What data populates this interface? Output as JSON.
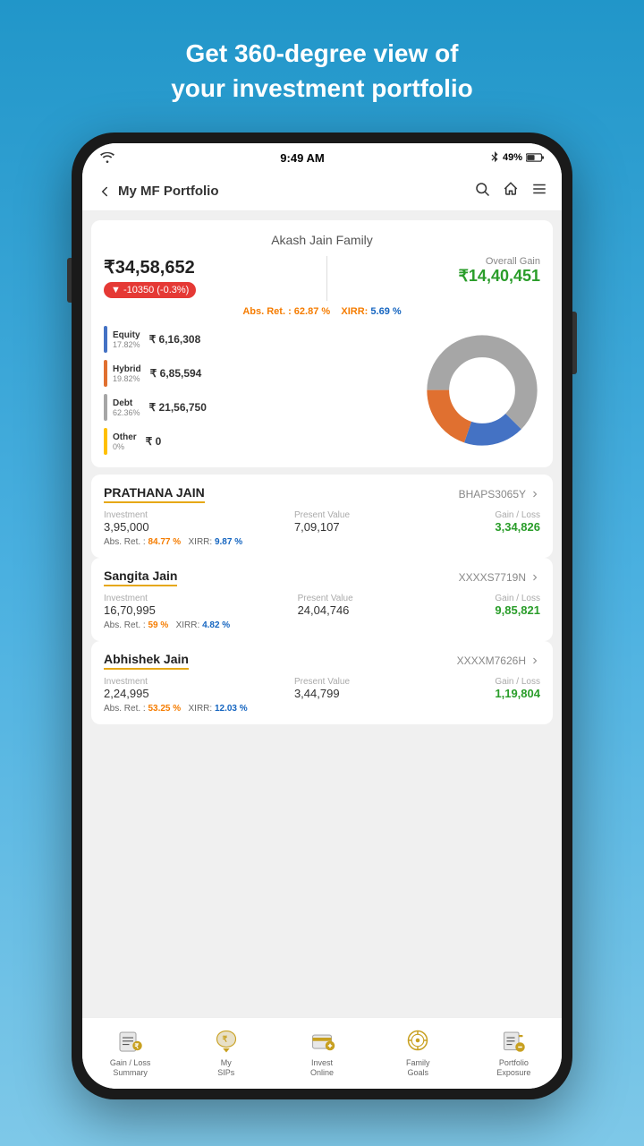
{
  "hero": {
    "line1": "Get 360-degree view of",
    "line2": "your investment portfolio"
  },
  "statusBar": {
    "time": "9:49 AM",
    "battery": "49%"
  },
  "navBar": {
    "backLabel": "My MF Portfolio"
  },
  "summaryCard": {
    "familyName": "Akash Jain Family",
    "totalValue": "₹34,58,652",
    "change": "▼ -10350  (-0.3%)",
    "overallGainLabel": "Overall Gain",
    "overallGainValue": "₹14,40,451",
    "absRet": "Abs. Ret. :  62.87 %",
    "xirr": "XIRR: 5.69 %",
    "categories": [
      {
        "name": "Equity",
        "pct": "17.82%",
        "value": "₹ 6,16,308",
        "color": "#4472c4"
      },
      {
        "name": "Hybrid",
        "pct": "19.82%",
        "value": "₹ 6,85,594",
        "color": "#e07030"
      },
      {
        "name": "Debt",
        "pct": "62.36%",
        "value": "₹ 21,56,750",
        "color": "#a6a6a6"
      },
      {
        "name": "Other",
        "pct": "0%",
        "value": "₹ 0",
        "color": "#ffc000"
      }
    ],
    "chart": {
      "segments": [
        {
          "label": "Equity",
          "value": 17.82,
          "color": "#4472c4"
        },
        {
          "label": "Hybrid",
          "value": 19.82,
          "color": "#e07030"
        },
        {
          "label": "Debt",
          "value": 62.36,
          "color": "#a6a6a6"
        }
      ]
    }
  },
  "persons": [
    {
      "name": "PRATHANA JAIN",
      "id": "BHAPS3065Y",
      "investment": "3,95,000",
      "presentValue": "7,09,107",
      "gainLoss": "3,34,826",
      "absRet": "84.77 %",
      "xirr": "9.87 %"
    },
    {
      "name": "Sangita Jain",
      "id": "XXXXS7719N",
      "investment": "16,70,995",
      "presentValue": "24,04,746",
      "gainLoss": "9,85,821",
      "absRet": "59 %",
      "xirr": "4.82 %"
    },
    {
      "name": "Abhishek Jain",
      "id": "XXXXM7626H",
      "investment": "2,24,995",
      "presentValue": "3,44,799",
      "gainLoss": "1,19,804",
      "absRet": "53.25 %",
      "xirr": "12.03 %"
    }
  ],
  "bottomNav": [
    {
      "label": "Gain / Loss\nSummary",
      "icon": "gain-loss"
    },
    {
      "label": "My\nSIPs",
      "icon": "sips"
    },
    {
      "label": "Invest\nOnline",
      "icon": "invest"
    },
    {
      "label": "Family\nGoals",
      "icon": "goals"
    },
    {
      "label": "Portfolio\nExposure",
      "icon": "exposure"
    }
  ],
  "labels": {
    "investment": "Investment",
    "presentValue": "Present Value",
    "gainLoss": "Gain / Loss",
    "absRet": "Abs. Ret. :",
    "xirr": "XIRR:"
  }
}
